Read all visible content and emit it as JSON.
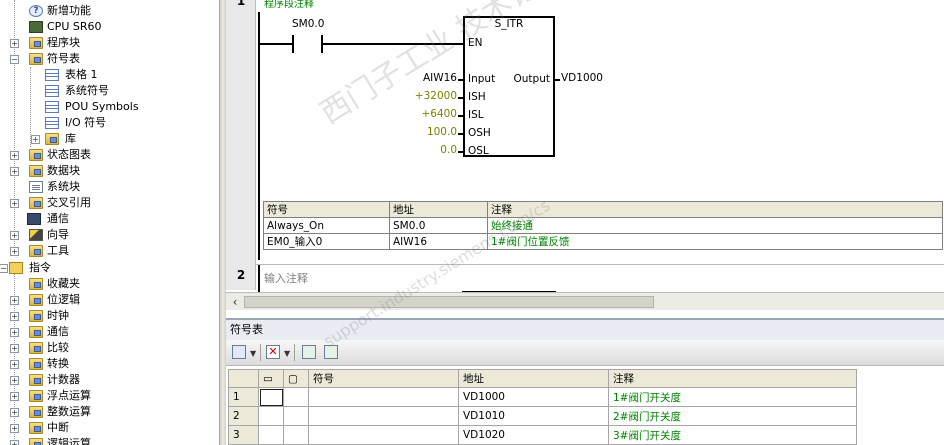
{
  "tree": {
    "top_label": "新增功能",
    "items": [
      {
        "label": "新增功能"
      },
      {
        "label": "CPU SR60"
      },
      {
        "label": "程序块"
      },
      {
        "label": "符号表"
      },
      {
        "label": "表格 1"
      },
      {
        "label": "系统符号"
      },
      {
        "label": "POU Symbols"
      },
      {
        "label": "I/O 符号"
      },
      {
        "label": "库"
      },
      {
        "label": "状态图表"
      },
      {
        "label": "数据块"
      },
      {
        "label": "系统块"
      },
      {
        "label": "交叉引用"
      },
      {
        "label": "通信"
      },
      {
        "label": "向导"
      },
      {
        "label": "工具"
      },
      {
        "label": "指令"
      },
      {
        "label": "收藏夹"
      },
      {
        "label": "位逻辑"
      },
      {
        "label": "时钟"
      },
      {
        "label": "通信"
      },
      {
        "label": "比较"
      },
      {
        "label": "转换"
      },
      {
        "label": "计数器"
      },
      {
        "label": "浮点运算"
      },
      {
        "label": "整数运算"
      },
      {
        "label": "中断"
      },
      {
        "label": "逻辑运算"
      }
    ]
  },
  "editor": {
    "network1": {
      "number": "1",
      "comment": "程序段注释",
      "contact": "SM0.0",
      "box_name": "S_ITR",
      "pins": {
        "en": "EN",
        "input": "Input",
        "ish": "ISH",
        "isl": "ISL",
        "osh": "OSH",
        "osl": "OSL",
        "output": "Output"
      },
      "operands": {
        "input": "AIW16",
        "ish": "+32000",
        "isl": "+6400",
        "osh": "100.0",
        "osl": "0.0",
        "output": "VD1000"
      },
      "symbol_table": {
        "headers": [
          "符号",
          "地址",
          "注释"
        ],
        "rows": [
          [
            "Always_On",
            "SM0.0",
            "始终接通"
          ],
          [
            "EM0_输入0",
            "AIW16",
            "1#阀门位置反馈"
          ]
        ]
      }
    },
    "network2": {
      "number": "2",
      "comment": "输入注释"
    }
  },
  "symbol_panel": {
    "title": "符号表",
    "headers": [
      "符号",
      "地址",
      "注释"
    ],
    "rows": [
      {
        "num": "1",
        "symbol": "",
        "address": "VD1000",
        "comment": "1#阀门开关度"
      },
      {
        "num": "2",
        "symbol": "",
        "address": "VD1010",
        "comment": "2#阀门开关度"
      },
      {
        "num": "3",
        "symbol": "",
        "address": "VD1020",
        "comment": "3#阀门开关度"
      }
    ]
  },
  "watermark": {
    "text": "西门子工业 技术论坛",
    "url": "support.industry.siemens.com/cs"
  },
  "colors": {
    "comment_green": "#008000",
    "operand_olive": "#808000",
    "header_bg": "#ece9d8"
  }
}
